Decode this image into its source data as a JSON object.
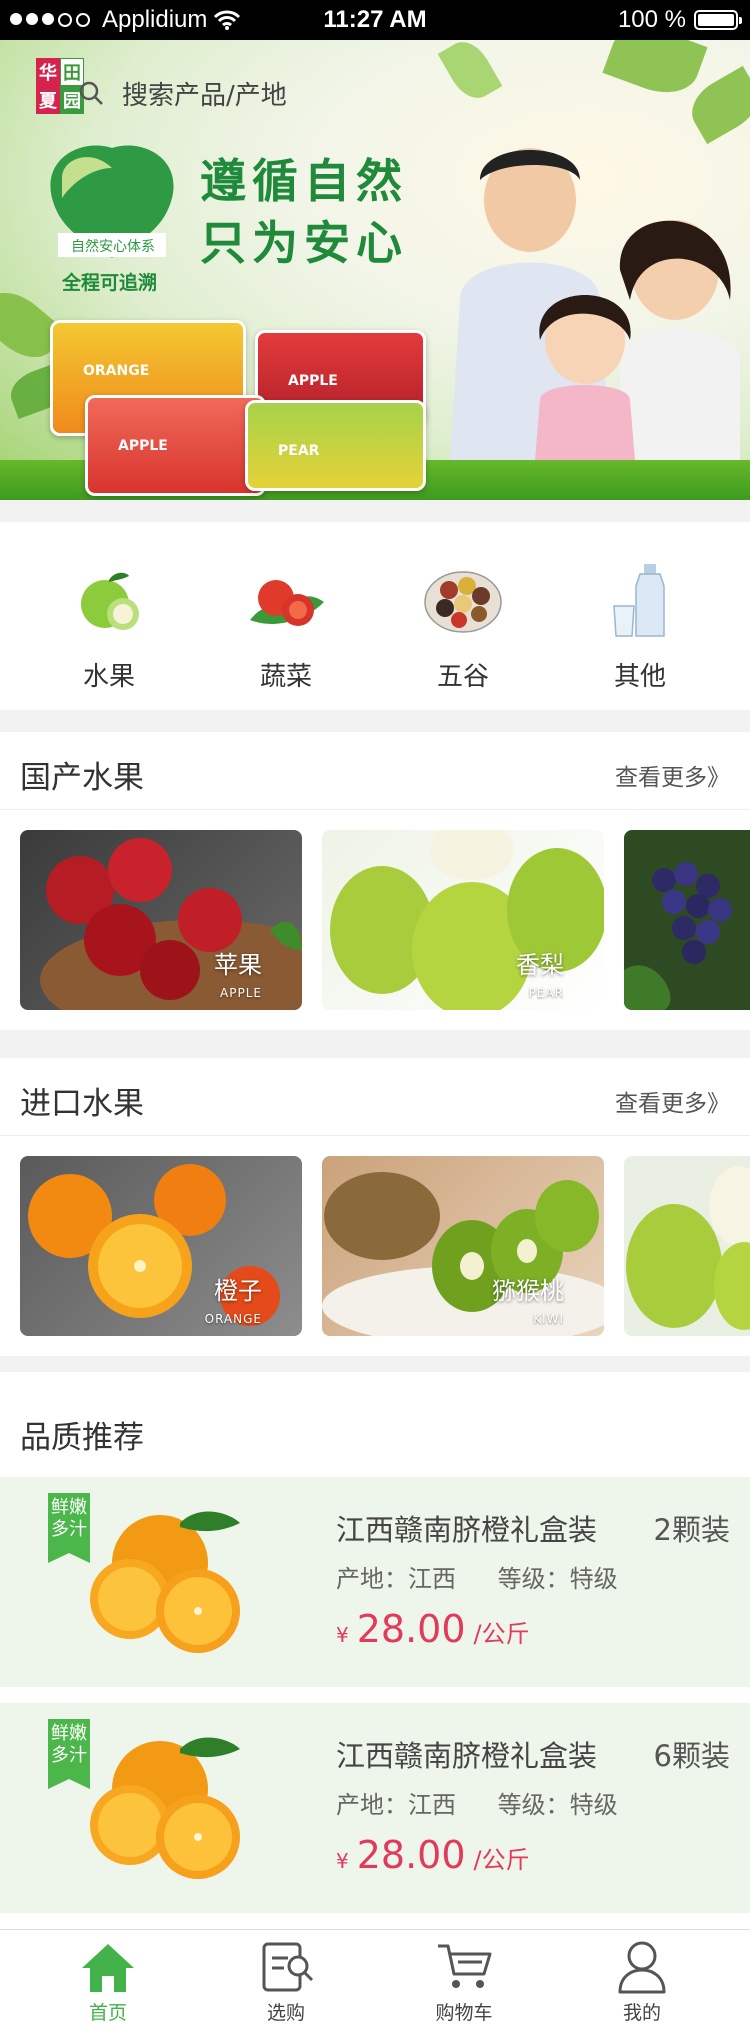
{
  "status_bar": {
    "carrier": "Applidium",
    "time": "11:27 AM",
    "battery": "100 %"
  },
  "header": {
    "logo_chars": [
      "华",
      "田",
      "夏",
      "园"
    ],
    "search_placeholder": "搜索产品/产地"
  },
  "banner": {
    "slogan_line1": "遵循自然",
    "slogan_line2": "只为安心",
    "badge_text": "自然安心体系",
    "trace_text": "全程可追溯",
    "packs": [
      {
        "label": "ORANGE"
      },
      {
        "label": "APPLE"
      },
      {
        "label": "APPLE"
      },
      {
        "label": "PEAR"
      }
    ]
  },
  "categories": [
    {
      "label": "水果",
      "icon": "apple-icon"
    },
    {
      "label": "蔬菜",
      "icon": "tomato-icon"
    },
    {
      "label": "五谷",
      "icon": "grains-icon"
    },
    {
      "label": "其他",
      "icon": "water-bottle-icon"
    }
  ],
  "domestic": {
    "title": "国产水果",
    "more": "查看更多》",
    "items": [
      {
        "name": "苹果",
        "en": "APPLE"
      },
      {
        "name": "香梨",
        "en": "PEAR"
      }
    ]
  },
  "imported": {
    "title": "进口水果",
    "more": "查看更多》",
    "items": [
      {
        "name": "橙子",
        "en": "ORANGE"
      },
      {
        "name": "猕猴桃",
        "en": "KIWI"
      }
    ]
  },
  "recommend": {
    "title": "品质推荐",
    "products": [
      {
        "tag": "鲜嫩多汁",
        "name": "江西赣南脐橙礼盒装",
        "count": "2颗装",
        "origin": "产地：江西",
        "grade": "等级：特级",
        "currency": "¥",
        "price": "28.00",
        "unit": "/公斤"
      },
      {
        "tag": "鲜嫩多汁",
        "name": "江西赣南脐橙礼盒装",
        "count": "6颗装",
        "origin": "产地：江西",
        "grade": "等级：特级",
        "currency": "¥",
        "price": "28.00",
        "unit": "/公斤"
      }
    ]
  },
  "tabbar": {
    "items": [
      {
        "label": "首页",
        "icon": "home-icon",
        "active": true
      },
      {
        "label": "选购",
        "icon": "shopping-list-icon",
        "active": false
      },
      {
        "label": "购物车",
        "icon": "cart-icon",
        "active": false
      },
      {
        "label": "我的",
        "icon": "user-icon",
        "active": false
      }
    ],
    "active_color": "#43b24b"
  }
}
